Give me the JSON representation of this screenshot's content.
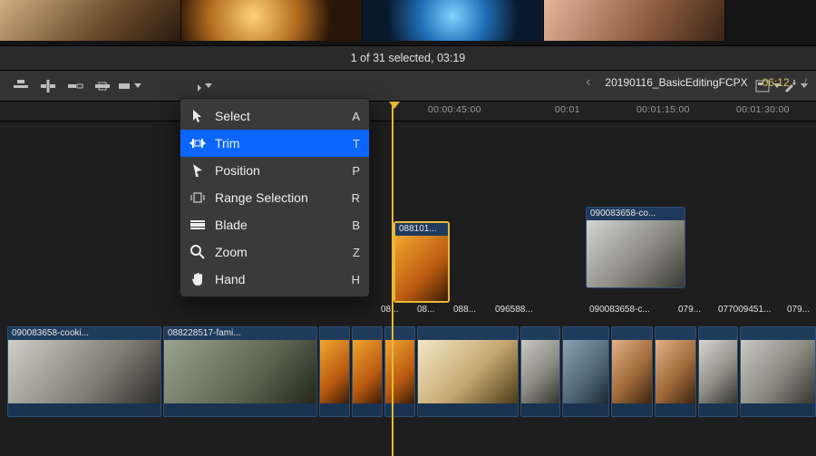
{
  "selection_status": "1 of 31 selected, 03:19",
  "project": {
    "name": "20190116_BasicEditingFCPX",
    "duration": "06:12",
    "separator": "/"
  },
  "timecodes": [
    "00:00:45:00",
    "00:01",
    "00:01:15:00",
    "00:01:30:00"
  ],
  "tools_menu": [
    {
      "label": "Select",
      "shortcut": "A",
      "icon": "select"
    },
    {
      "label": "Trim",
      "shortcut": "T",
      "icon": "trim"
    },
    {
      "label": "Position",
      "shortcut": "P",
      "icon": "position"
    },
    {
      "label": "Range Selection",
      "shortcut": "R",
      "icon": "range"
    },
    {
      "label": "Blade",
      "shortcut": "B",
      "icon": "blade"
    },
    {
      "label": "Zoom",
      "shortcut": "Z",
      "icon": "zoom"
    },
    {
      "label": "Hand",
      "shortcut": "H",
      "icon": "hand"
    }
  ],
  "tools_selected_index": 1,
  "upper_clips": {
    "c1": "088101...",
    "c2": "090083658-co..."
  },
  "row2_labels": [
    "08...",
    "08...",
    "088...",
    "096588...",
    "090083658-c...",
    "079...",
    "077009451...",
    "079..."
  ],
  "story_clips": [
    {
      "label": "090083658-cooki...",
      "cls": "sc-a"
    },
    {
      "label": "088228517-fami...",
      "cls": "sc-b"
    },
    {
      "label": "",
      "cls": "sc-c"
    },
    {
      "label": "",
      "cls": "sc-c2"
    },
    {
      "label": "",
      "cls": "sc-c3"
    },
    {
      "label": "",
      "cls": "sc-d"
    },
    {
      "label": "",
      "cls": "sc-e"
    },
    {
      "label": "",
      "cls": "sc-f"
    },
    {
      "label": "",
      "cls": "sc-g"
    },
    {
      "label": "",
      "cls": "sc-g2"
    },
    {
      "label": "",
      "cls": "sc-h"
    },
    {
      "label": "",
      "cls": "sc-rest"
    }
  ]
}
